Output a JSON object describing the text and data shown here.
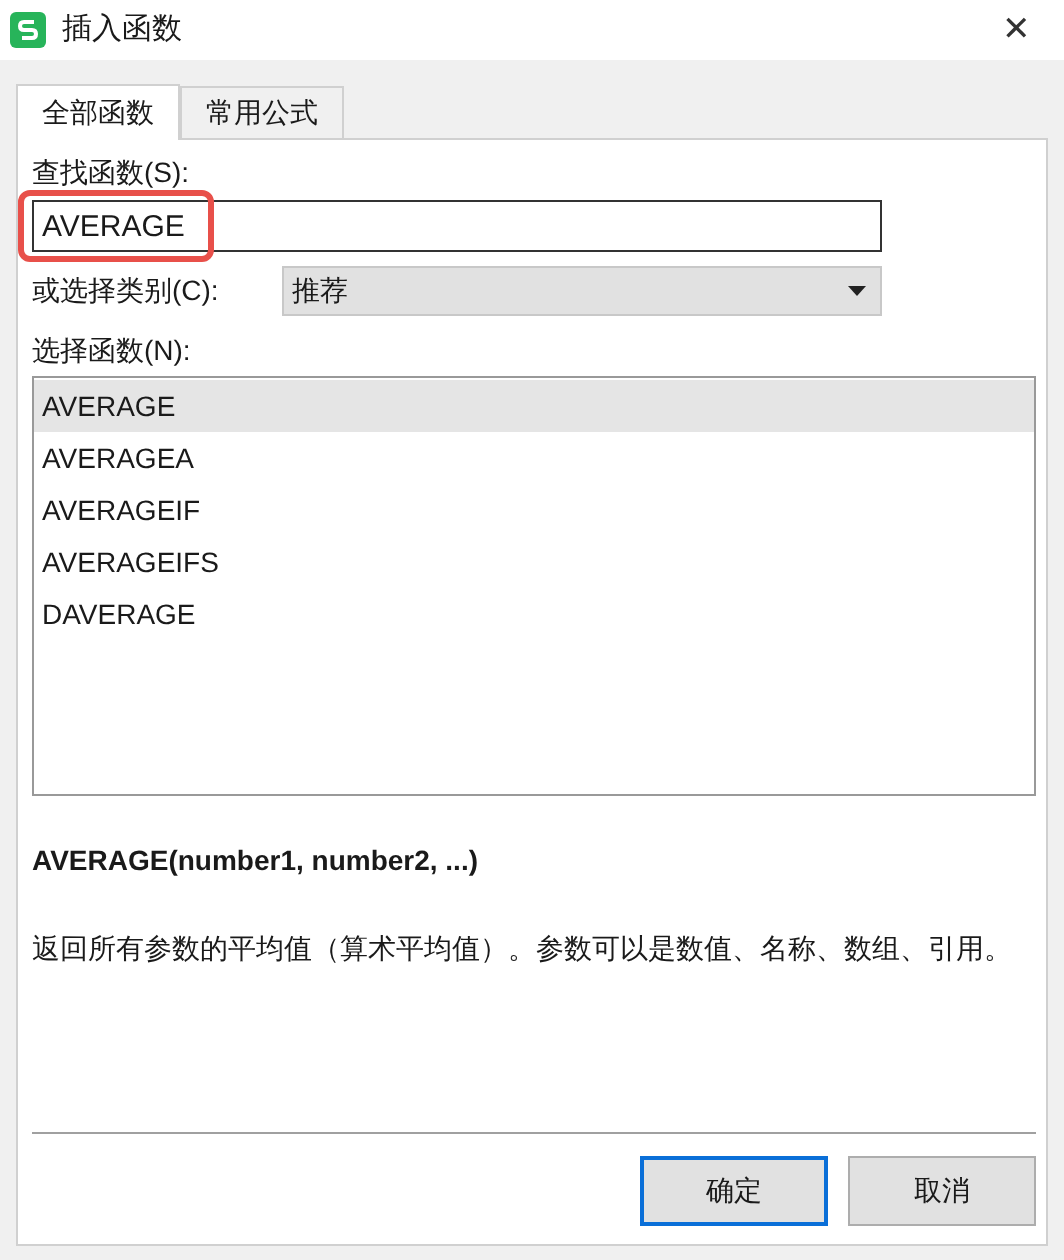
{
  "window": {
    "title": "插入函数",
    "close": "✕"
  },
  "tabs": [
    {
      "label": "全部函数",
      "selected": true
    },
    {
      "label": "常用公式",
      "selected": false
    }
  ],
  "search": {
    "label": "查找函数(S):",
    "value": "AVERAGE",
    "highlighted": true
  },
  "category": {
    "label": "或选择类别(C):",
    "value": "推荐"
  },
  "function_list": {
    "label": "选择函数(N):",
    "items": [
      {
        "name": "AVERAGE",
        "selected": true
      },
      {
        "name": "AVERAGEA",
        "selected": false
      },
      {
        "name": "AVERAGEIF",
        "selected": false
      },
      {
        "name": "AVERAGEIFS",
        "selected": false
      },
      {
        "name": "DAVERAGE",
        "selected": false
      }
    ]
  },
  "syntax": "AVERAGE(number1, number2, ...)",
  "description": "返回所有参数的平均值（算术平均值）。参数可以是数值、名称、数组、引用。",
  "buttons": [
    {
      "label": "确定",
      "default": true
    },
    {
      "label": "取消",
      "default": false
    }
  ]
}
